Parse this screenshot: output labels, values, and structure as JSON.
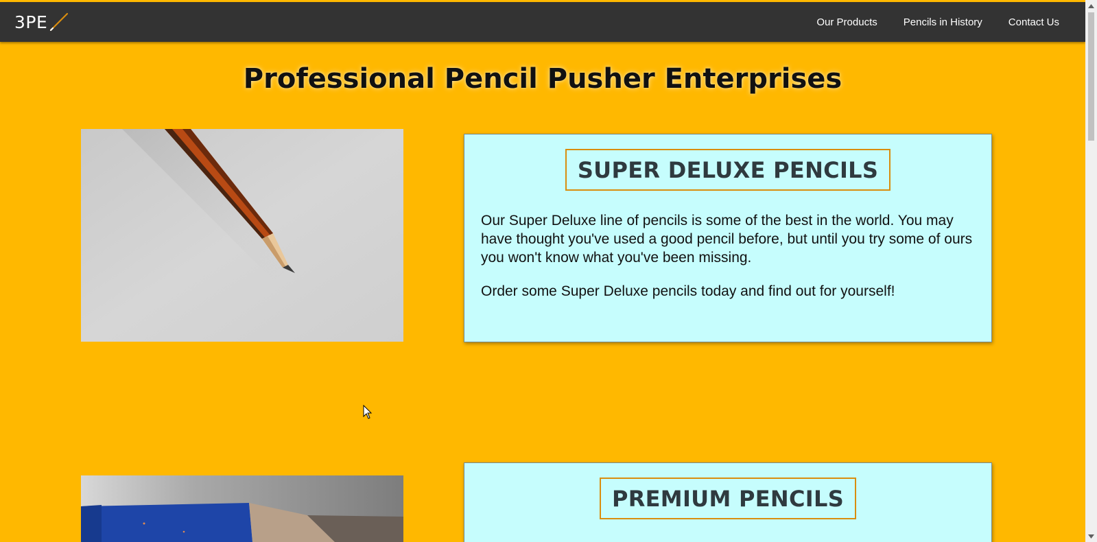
{
  "header": {
    "logo_text": "3PE",
    "nav": [
      {
        "label": "Our Products"
      },
      {
        "label": "Pencils in History"
      },
      {
        "label": "Contact Us"
      }
    ]
  },
  "main": {
    "title": "Professional Pencil Pusher Enterprises",
    "products": [
      {
        "title": "SUPER DELUXE PENCILS",
        "paragraphs": [
          "Our Super Deluxe line of pencils is some of the best in the world. You may have thought you've used a good pencil before, but until you try some of ours you won't know what you've been missing.",
          "Order some Super Deluxe pencils today and find out for yourself!"
        ]
      },
      {
        "title": "PREMIUM PENCILS",
        "paragraphs": []
      }
    ]
  },
  "colors": {
    "background": "#ffb800",
    "topbar": "#333333",
    "card_background": "#c6fdfd",
    "card_title_border": "#d98d0e"
  },
  "icons": [
    "pencil-logo-icon",
    "scroll-up-arrow-icon",
    "scroll-down-arrow-icon",
    "mouse-cursor-icon"
  ]
}
